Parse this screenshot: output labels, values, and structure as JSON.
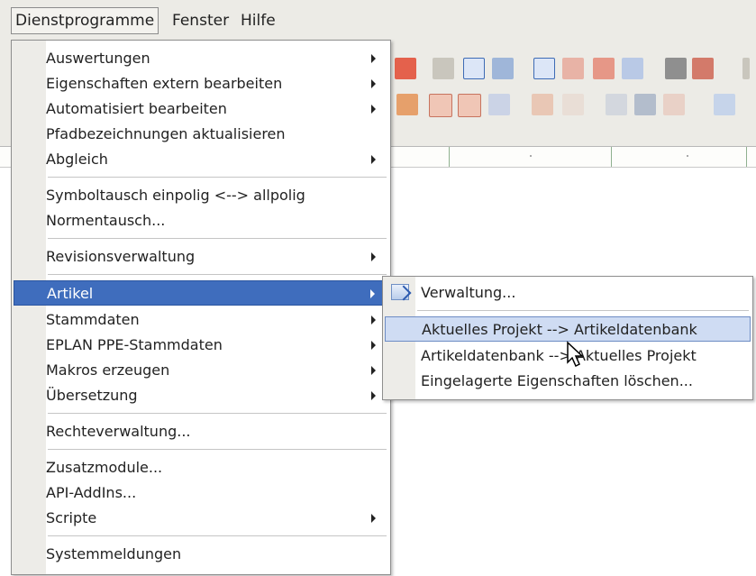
{
  "menubar": {
    "items": [
      "Dienstprogramme",
      "Fenster",
      "Hilfe"
    ]
  },
  "main_menu": {
    "items": [
      {
        "label": "Auswertungen",
        "submenu": true
      },
      {
        "label": "Eigenschaften extern bearbeiten",
        "submenu": true
      },
      {
        "label": "Automatisiert bearbeiten",
        "submenu": true
      },
      {
        "label": "Pfadbezeichnungen aktualisieren",
        "submenu": false
      },
      {
        "label": "Abgleich",
        "submenu": true
      },
      {
        "label": "Symboltausch einpolig <--> allpolig",
        "submenu": false
      },
      {
        "label": "Normentausch...",
        "submenu": false
      },
      {
        "label": "Revisionsverwaltung",
        "submenu": true
      },
      {
        "label": "Artikel",
        "submenu": true,
        "state": "highlighted"
      },
      {
        "label": "Stammdaten",
        "submenu": true
      },
      {
        "label": "EPLAN PPE-Stammdaten",
        "submenu": true
      },
      {
        "label": "Makros erzeugen",
        "submenu": true
      },
      {
        "label": "Übersetzung",
        "submenu": true
      },
      {
        "label": "Rechteverwaltung...",
        "submenu": false
      },
      {
        "label": "Zusatzmodule...",
        "submenu": false
      },
      {
        "label": "API-AddIns...",
        "submenu": false
      },
      {
        "label": "Scripte",
        "submenu": true
      },
      {
        "label": "Systemmeldungen",
        "submenu": false
      }
    ]
  },
  "submenu_artikel": {
    "items": [
      {
        "label": "Verwaltung...",
        "icon": "article-management-icon"
      },
      {
        "label": "Aktuelles Projekt --> Artikeldatenbank",
        "state": "hover"
      },
      {
        "label": "Artikeldatenbank --> Aktuelles Projekt"
      },
      {
        "label": "Eingelagerte Eigenschaften löschen..."
      }
    ]
  },
  "colors": {
    "menu_highlight": "#3f6dbd",
    "menu_hover": "#cfdcf3",
    "menubar_bg": "#ecebe6"
  }
}
